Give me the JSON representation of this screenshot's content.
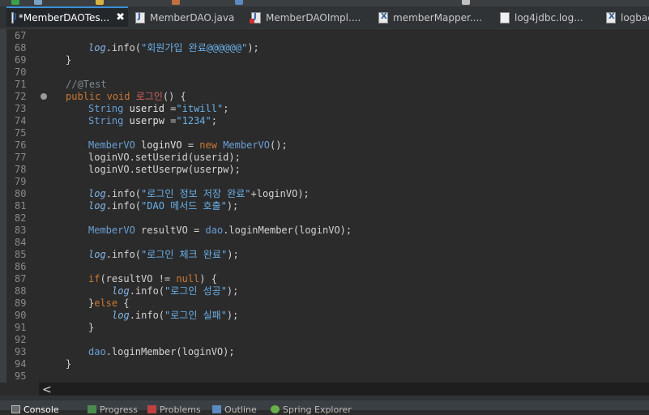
{
  "tabs": [
    {
      "label": "*MemberDAOTes...",
      "icon": "java-file-icon",
      "active": true,
      "closable": true
    },
    {
      "label": "MemberDAO.java",
      "icon": "java-file-icon",
      "active": false
    },
    {
      "label": "MemberDAOImpl....",
      "icon": "java-file-error-icon",
      "active": false
    },
    {
      "label": "memberMapper....",
      "icon": "xml-file-icon",
      "active": false
    },
    {
      "label": "log4jdbc.log...",
      "icon": "properties-file-icon",
      "active": false
    },
    {
      "label": "logbac",
      "icon": "xml-file-icon",
      "active": false
    }
  ],
  "close_glyph": "✖",
  "line_numbers": [
    "67",
    "68",
    "69",
    "70",
    "71",
    "72",
    "73",
    "74",
    "75",
    "76",
    "77",
    "78",
    "79",
    "80",
    "81",
    "82",
    "83",
    "84",
    "85",
    "86",
    "87",
    "88",
    "89",
    "90",
    "91",
    "92",
    "93",
    "94",
    "95"
  ],
  "code": {
    "l68_log": "log",
    "l68_rest": ".info(",
    "l68_str": "\"회원가입 완료@@@@@@\"",
    "l68_end": ");",
    "l69": "}",
    "l71": "//@Test",
    "l72_kw1": "public",
    "l72_kw2": "void",
    "l72_name": "로그인",
    "l72_end": "() {",
    "l73_type": "String",
    "l73_var": "userid",
    "l73_eq": " =",
    "l73_str": "\"itwill\"",
    "l73_end": ";",
    "l74_type": "String",
    "l74_var": "userpw",
    "l74_eq": " =",
    "l74_str": "\"1234\"",
    "l74_end": ";",
    "l76_type": "MemberVO",
    "l76_var": "loginVO",
    "l76_eq": " = ",
    "l76_kw": "new",
    "l76_ctor": " MemberVO",
    "l76_end": "();",
    "l77": "loginVO.setUserid(userid);",
    "l78": "loginVO.setUserpw(userpw);",
    "l80_log": "log",
    "l80_rest": ".info(",
    "l80_str": "\"로그인 정보 저장 완료\"",
    "l80_end": "+loginVO);",
    "l81_log": "log",
    "l81_rest": ".info(",
    "l81_str": "\"DAO 메서드 호출\"",
    "l81_end": ");",
    "l83_type": "MemberVO",
    "l83_rest": " resultVO = ",
    "l83_dao": "dao",
    "l83_end": ".loginMember(loginVO);",
    "l85_log": "log",
    "l85_rest": ".info(",
    "l85_str": "\"로그인 체크 완료\"",
    "l85_end": ");",
    "l87_kw": "if",
    "l87_mid": "(resultVO != ",
    "l87_null": "null",
    "l87_end": ") {",
    "l88_log": "log",
    "l88_rest": ".info(",
    "l88_str": "\"로그인 성공\"",
    "l88_end": ");",
    "l89_brace": "}",
    "l89_kw": "else",
    "l89_end": " {",
    "l90_log": "log",
    "l90_rest": ".info(",
    "l90_str": "\"로그인 실패\"",
    "l90_end": ");",
    "l91": "}",
    "l93_dao": "dao",
    "l93_end": ".loginMember(loginVO);",
    "l94": "}"
  },
  "scroll_left_glyph": "<",
  "bottom_tabs": [
    {
      "label": "Console",
      "icon": "console-icon"
    },
    {
      "label": "Progress",
      "icon": "progress-icon"
    },
    {
      "label": "Problems",
      "icon": "problems-icon"
    },
    {
      "label": "Outline",
      "icon": "outline-icon"
    },
    {
      "label": "Spring Explorer",
      "icon": "spring-icon"
    }
  ],
  "colors": {
    "editor_bg": "#2b2b2b",
    "keyword": "#cc7832",
    "type": "#6a9fd6",
    "string": "#6ab0e8",
    "comment": "#7d8c93",
    "active_tab_accent": "#3b8fd6"
  }
}
